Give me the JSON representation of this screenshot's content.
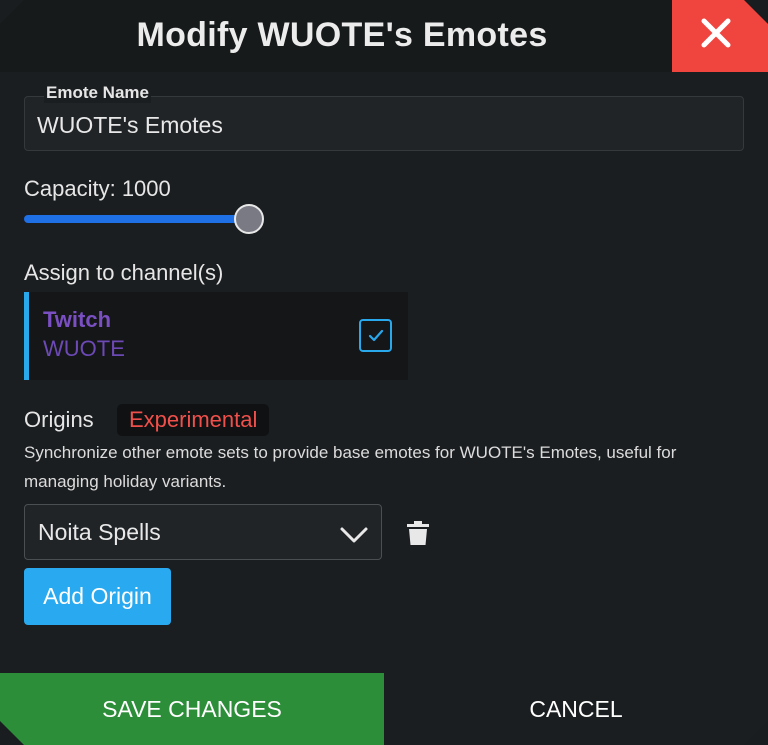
{
  "header": {
    "title": "Modify WUOTE's Emotes",
    "close_icon": "close-icon",
    "close_color": "#f0453f"
  },
  "name_field": {
    "label": "Emote Name",
    "value": "WUOTE's Emotes"
  },
  "capacity": {
    "label": "Capacity: 1000",
    "slider_fill_fraction": 1.0,
    "accent": "#1f6fe5"
  },
  "assign": {
    "label": "Assign to channel(s)",
    "channels": [
      {
        "platform": "Twitch",
        "name": "WUOTE",
        "checked": true,
        "platform_color": "#7a4fc2"
      }
    ]
  },
  "origins": {
    "label": "Origins",
    "badge": "Experimental",
    "description": "Synchronize other emote sets to provide base emotes for WUOTE's Emotes, useful for managing holiday variants.",
    "items": [
      {
        "selected": "Noita Spells",
        "dropdown_icon": "chevron-down-icon",
        "delete_icon": "trash-icon"
      }
    ],
    "add_label": "Add Origin"
  },
  "footer": {
    "save_label": "SAVE CHANGES",
    "cancel_label": "CANCEL",
    "save_color": "#2d8e3a"
  }
}
